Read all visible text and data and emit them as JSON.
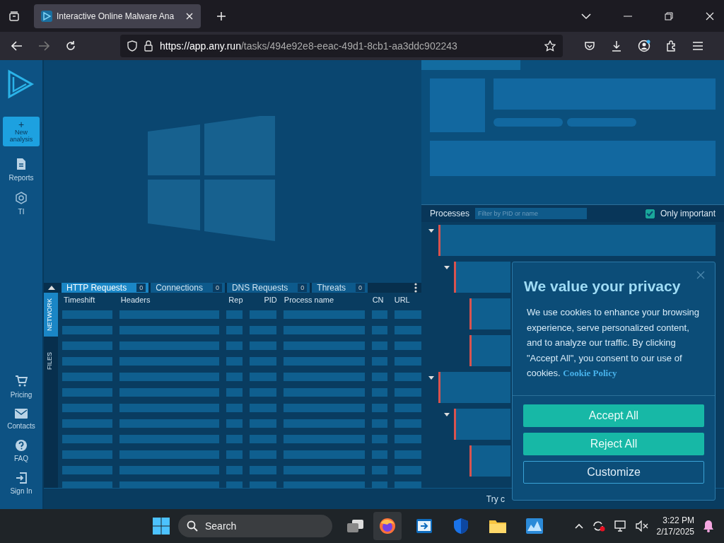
{
  "browser": {
    "tab_title": "Interactive Online Malware Ana",
    "url_host": "https://app.any.run",
    "url_path": "/tasks/494e92e8-eeac-49d1-8cb1-aa3ddc902243"
  },
  "sidebar": {
    "new_button": {
      "icon": "+",
      "label": "New analysis"
    },
    "items": [
      {
        "label": "Reports",
        "kind": "doc"
      },
      {
        "label": "TI",
        "kind": "hex"
      }
    ],
    "bottom_items": [
      {
        "label": "Pricing",
        "kind": "cart"
      },
      {
        "label": "Contacts",
        "kind": "mail"
      },
      {
        "label": "FAQ",
        "kind": "help"
      },
      {
        "label": "Sign In",
        "kind": "signin"
      }
    ]
  },
  "network": {
    "side_tabs": [
      {
        "label": "NETWORK",
        "selected": true
      },
      {
        "label": "FILES",
        "selected": false
      }
    ],
    "tabs": [
      {
        "label": "HTTP Requests",
        "count": "0",
        "selected": true
      },
      {
        "label": "Connections",
        "count": "0",
        "selected": false
      },
      {
        "label": "DNS Requests",
        "count": "0",
        "selected": false
      },
      {
        "label": "Threats",
        "count": "0",
        "selected": false
      }
    ],
    "columns": [
      "Timeshift",
      "Headers",
      "Rep",
      "PID",
      "Process name",
      "CN",
      "URL"
    ]
  },
  "processes": {
    "title": "Processes",
    "filter_placeholder": "Filter by PID or name",
    "only_important": {
      "label": "Only important",
      "checked": true
    }
  },
  "status_bar": {
    "text": "Try c"
  },
  "cookie_dialog": {
    "title": "We value your privacy",
    "body": "We use cookies to enhance your browsing experience, serve personalized content, and to analyze our traffic. By clicking \"Accept All\", you consent to our use of cookies.",
    "link": "Cookie Policy",
    "buttons": [
      {
        "label": "Accept All",
        "kind": "primary"
      },
      {
        "label": "Reject All",
        "kind": "primary"
      },
      {
        "label": "Customize",
        "kind": "outline"
      }
    ]
  },
  "taskbar": {
    "search_placeholder": "Search",
    "time": "3:22 PM",
    "date": "2/17/2025"
  }
}
